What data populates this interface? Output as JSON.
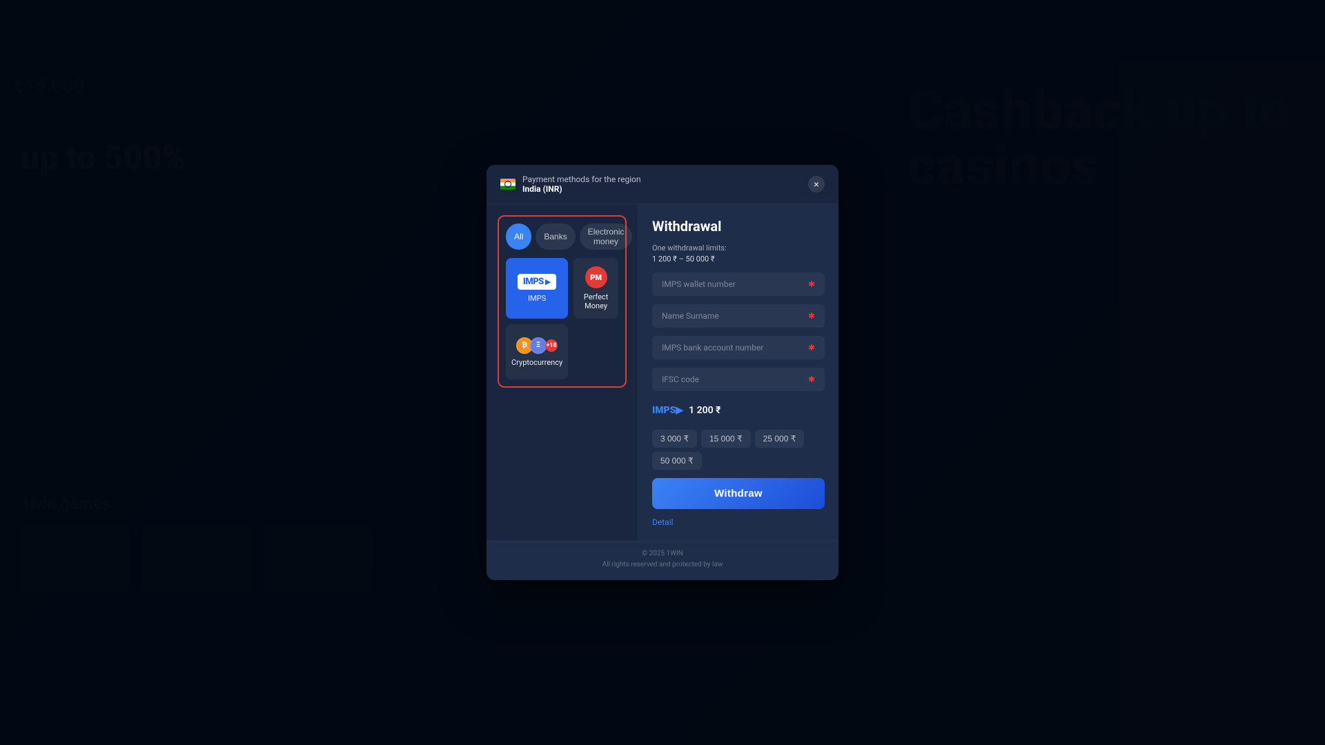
{
  "background": {
    "hero_text_line1": "Cashback up to",
    "hero_text_line2": "casinos",
    "left_promo_pct": "up to 500%",
    "balance": "₹15,000",
    "games_title": "1win games"
  },
  "modal": {
    "header": {
      "flag_label": "India",
      "region_label": "Payment methods for the region",
      "region_code": "India (INR)",
      "close_label": "×"
    },
    "left_panel": {
      "filter_tabs": [
        {
          "id": "all",
          "label": "All",
          "active": true
        },
        {
          "id": "banks",
          "label": "Banks",
          "active": false
        },
        {
          "id": "electronic",
          "label": "Electronic money",
          "active": false
        }
      ],
      "payment_methods": [
        {
          "id": "imps",
          "label": "IMPS",
          "selected": true
        },
        {
          "id": "perfect_money",
          "label": "Perfect Money",
          "selected": false
        },
        {
          "id": "cryptocurrency",
          "label": "Cryptocurrency",
          "selected": false
        }
      ],
      "crypto_count": "+18"
    },
    "right_panel": {
      "title": "Withdrawal",
      "limits_label": "One withdrawal limits:",
      "limits_range": "1 200 ₹ – 50 000 ₹",
      "fields": [
        {
          "id": "wallet",
          "placeholder": "IMPS wallet number",
          "required": true
        },
        {
          "id": "name",
          "placeholder": "Name Surname",
          "required": true
        },
        {
          "id": "account",
          "placeholder": "IMPS bank account number",
          "required": true
        },
        {
          "id": "ifsc",
          "placeholder": "IFSC code",
          "required": true
        }
      ],
      "amount_value": "1 200 ₹",
      "quick_amounts": [
        "3 000 ₹",
        "15 000 ₹",
        "25 000 ₹",
        "50 000 ₹"
      ],
      "withdraw_btn": "Withdraw",
      "detail_link": "Detail"
    },
    "footer": {
      "copyright": "© 2025 1WIN",
      "rights": "All rights reserved and protected by law"
    }
  }
}
